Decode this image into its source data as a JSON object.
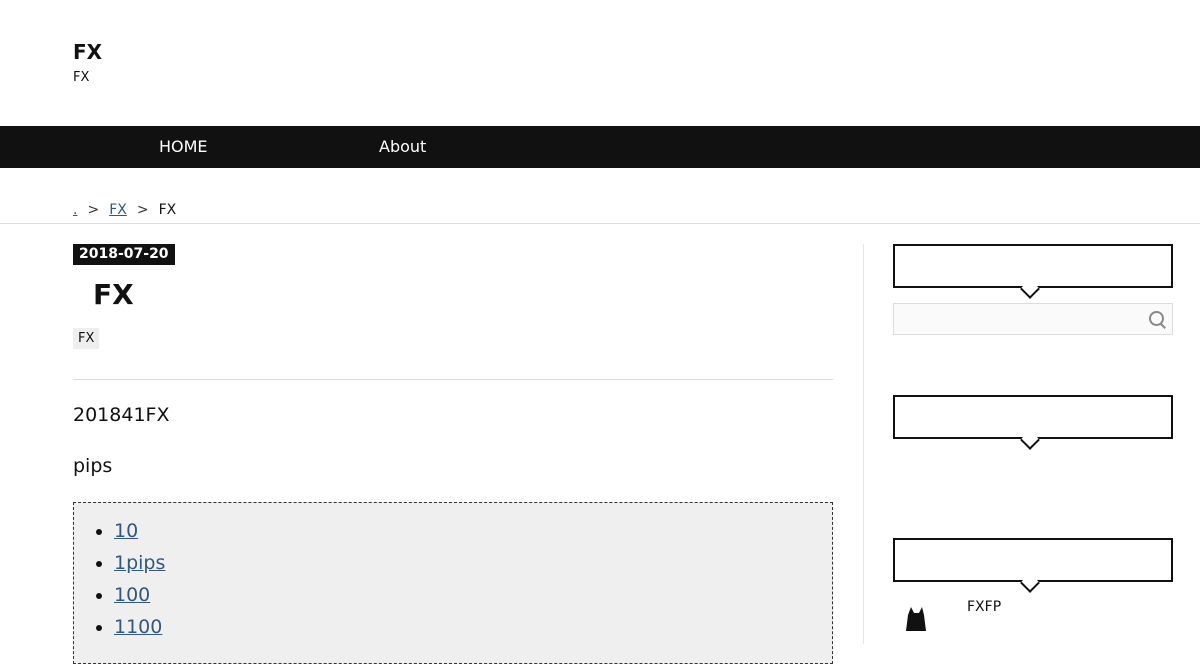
{
  "site": {
    "title": "FX",
    "description": "FX"
  },
  "nav": {
    "items": [
      "HOME",
      "About"
    ]
  },
  "breadcrumb": {
    "home": ".",
    "sep1": ">",
    "category": "FX",
    "sep2": ">",
    "current": "FX"
  },
  "post": {
    "date": "2018-07-20",
    "title": "FX",
    "category": "FX",
    "paragraphs": [
      "201841FX",
      "pips"
    ],
    "toc": [
      "10",
      "1pips",
      "100",
      "1100"
    ]
  },
  "sidebar": {
    "profile_name": "FXFP"
  },
  "colors": {
    "nav_bg": "#111111",
    "link": "#33587a",
    "toc_bg": "#efefef"
  }
}
